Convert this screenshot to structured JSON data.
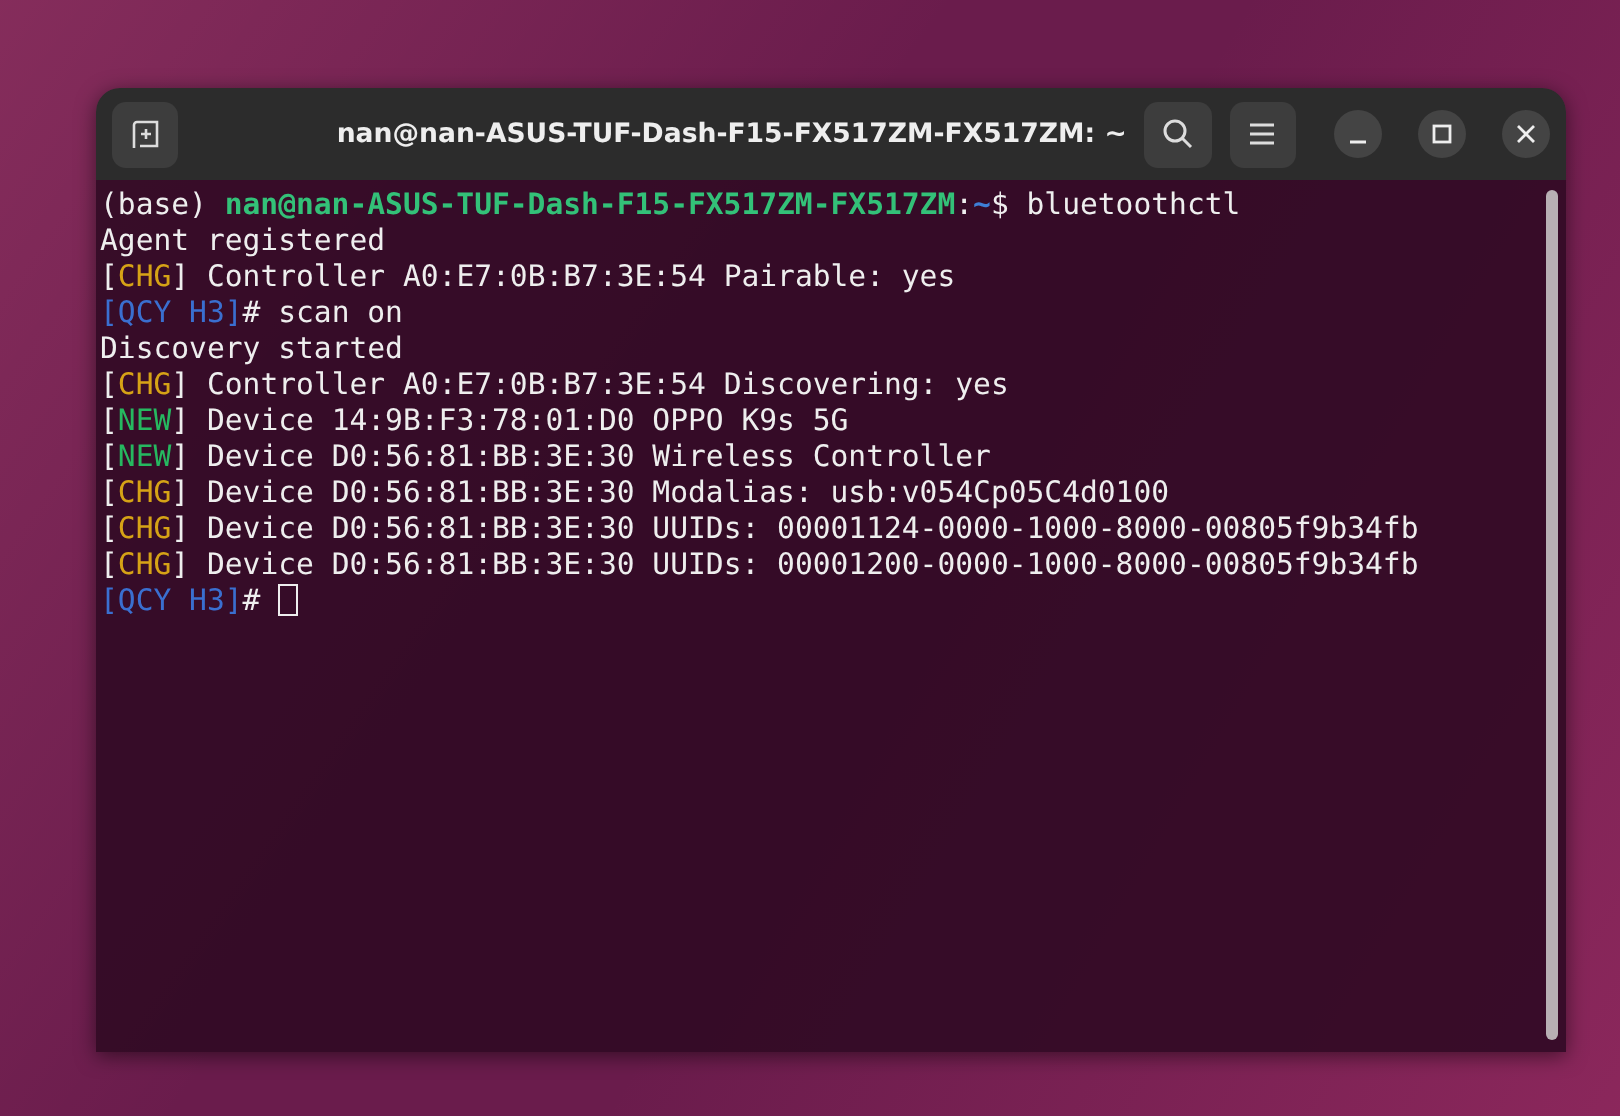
{
  "window": {
    "title": "nan@nan-ASUS-TUF-Dash-F15-FX517ZM-FX517ZM: ~"
  },
  "terminal": {
    "lines": [
      {
        "segments": [
          {
            "kind": "plain",
            "text": "(base) "
          },
          {
            "kind": "userhost",
            "text": "nan@nan-ASUS-TUF-Dash-F15-FX517ZM-FX517ZM"
          },
          {
            "kind": "plain",
            "text": ":"
          },
          {
            "kind": "path",
            "text": "~"
          },
          {
            "kind": "plain",
            "text": "$ bluetoothctl"
          }
        ]
      },
      {
        "segments": [
          {
            "kind": "plain",
            "text": "Agent registered"
          }
        ]
      },
      {
        "segments": [
          {
            "kind": "plain",
            "text": "["
          },
          {
            "kind": "chg",
            "text": "CHG"
          },
          {
            "kind": "plain",
            "text": "] Controller A0:E7:0B:B7:3E:54 Pairable: yes"
          }
        ]
      },
      {
        "segments": [
          {
            "kind": "prompt",
            "text": "[QCY H3]"
          },
          {
            "kind": "plain",
            "text": "# scan on"
          }
        ]
      },
      {
        "segments": [
          {
            "kind": "plain",
            "text": "Discovery started"
          }
        ]
      },
      {
        "segments": [
          {
            "kind": "plain",
            "text": "["
          },
          {
            "kind": "chg",
            "text": "CHG"
          },
          {
            "kind": "plain",
            "text": "] Controller A0:E7:0B:B7:3E:54 Discovering: yes"
          }
        ]
      },
      {
        "segments": [
          {
            "kind": "plain",
            "text": "["
          },
          {
            "kind": "new",
            "text": "NEW"
          },
          {
            "kind": "plain",
            "text": "] Device 14:9B:F3:78:01:D0 OPPO K9s 5G"
          }
        ]
      },
      {
        "segments": [
          {
            "kind": "plain",
            "text": "["
          },
          {
            "kind": "new",
            "text": "NEW"
          },
          {
            "kind": "plain",
            "text": "] Device D0:56:81:BB:3E:30 Wireless Controller"
          }
        ]
      },
      {
        "segments": [
          {
            "kind": "plain",
            "text": "["
          },
          {
            "kind": "chg",
            "text": "CHG"
          },
          {
            "kind": "plain",
            "text": "] Device D0:56:81:BB:3E:30 Modalias: usb:v054Cp05C4d0100"
          }
        ]
      },
      {
        "segments": [
          {
            "kind": "plain",
            "text": "["
          },
          {
            "kind": "chg",
            "text": "CHG"
          },
          {
            "kind": "plain",
            "text": "] Device D0:56:81:BB:3E:30 UUIDs: 00001124-0000-1000-8000-00805f9b34fb"
          }
        ]
      },
      {
        "segments": [
          {
            "kind": "plain",
            "text": "["
          },
          {
            "kind": "chg",
            "text": "CHG"
          },
          {
            "kind": "plain",
            "text": "] Device D0:56:81:BB:3E:30 UUIDs: 00001200-0000-1000-8000-00805f9b34fb"
          }
        ]
      },
      {
        "segments": [
          {
            "kind": "prompt",
            "text": "[QCY H3]"
          },
          {
            "kind": "plain",
            "text": "# "
          }
        ],
        "cursor": true
      }
    ]
  }
}
